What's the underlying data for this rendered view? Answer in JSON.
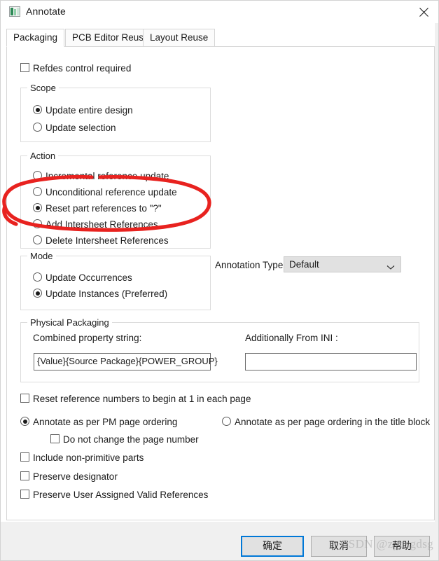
{
  "window": {
    "title": "Annotate",
    "icon": "annotate-window-icon",
    "close_icon": "close-icon"
  },
  "tabs": [
    {
      "label": "Packaging",
      "active": true
    },
    {
      "label": "PCB Editor Reuse",
      "active": false
    },
    {
      "label": "Layout Reuse",
      "active": false
    }
  ],
  "top_options": {
    "refdes_control": {
      "label": "Refdes control required",
      "checked": false
    }
  },
  "scope": {
    "title": "Scope",
    "options": [
      {
        "label": "Update entire design",
        "selected": true
      },
      {
        "label": "Update selection",
        "selected": false
      }
    ]
  },
  "action": {
    "title": "Action",
    "options": [
      {
        "label": "Incremental reference update",
        "selected": false
      },
      {
        "label": "Unconditional reference update",
        "selected": false
      },
      {
        "label": "Reset part references to \"?\"",
        "selected": true
      },
      {
        "label": "Add Intersheet References",
        "selected": false
      },
      {
        "label": "Delete Intersheet References",
        "selected": false
      }
    ]
  },
  "mode": {
    "title": "Mode",
    "options": [
      {
        "label": "Update Occurrences",
        "selected": false
      },
      {
        "label": "Update Instances (Preferred)",
        "selected": true
      }
    ]
  },
  "annotation_type": {
    "label": "Annotation Type",
    "value": "Default",
    "chevron_icon": "chevron-down-icon"
  },
  "physical_packaging": {
    "title": "Physical Packaging",
    "combined_property_label": "Combined property string:",
    "combined_property_value": "{Value}{Source Package}{POWER_GROUP}",
    "additionally_from_ini_label": "Additionally From INI :",
    "additionally_from_ini_value": ""
  },
  "bottom_options": {
    "reset_reference_numbers": {
      "label": "Reset reference numbers to begin at 1 in each page",
      "checked": false
    },
    "annotate_pm_page_ordering": {
      "label": "Annotate as per PM page ordering",
      "selected": true
    },
    "annotate_title_block_ordering": {
      "label": "Annotate as per page ordering in the title block",
      "selected": false
    },
    "do_not_change_page_number": {
      "label": "Do not change the page number",
      "checked": false
    },
    "include_non_primitive": {
      "label": "Include non-primitive parts",
      "checked": false
    },
    "preserve_designator": {
      "label": "Preserve designator",
      "checked": false
    },
    "preserve_user_assigned": {
      "label": "Preserve User Assigned Valid References",
      "checked": false
    }
  },
  "footer": {
    "ok_label": "确定",
    "cancel_label": "取消",
    "help_label": "帮助"
  },
  "watermark": {
    "text": "CSDN @zycsgdsg"
  },
  "annotation_markup": {
    "type": "hand-drawn-red-ellipse",
    "color": "#e8221f",
    "encircles": [
      "Unconditional reference update",
      "Reset part references to \"?\"",
      "Add Intersheet References"
    ]
  }
}
